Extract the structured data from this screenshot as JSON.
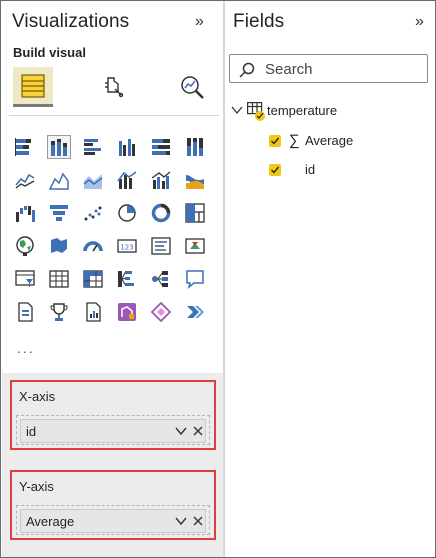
{
  "visualizations": {
    "title": "Visualizations",
    "collapse_glyph": "»",
    "build_visual_label": "Build visual",
    "build_icons": [
      "build-visual-icon",
      "format-visual-icon",
      "analytics-icon"
    ],
    "viz_icons": [
      "stacked-bar-chart-icon",
      "stacked-column-chart-icon",
      "clustered-bar-chart-icon",
      "clustered-column-chart-icon",
      "100-stacked-bar-chart-icon",
      "100-stacked-column-chart-icon",
      "line-chart-icon",
      "area-chart-icon",
      "stacked-area-chart-icon",
      "line-and-stacked-column-chart-icon",
      "line-and-clustered-column-chart-icon",
      "ribbon-chart-icon",
      "waterfall-chart-icon",
      "funnel-chart-icon",
      "scatter-chart-icon",
      "pie-chart-icon",
      "donut-chart-icon",
      "treemap-icon",
      "map-icon",
      "filled-map-icon",
      "gauge-icon",
      "card-icon",
      "multi-row-card-icon",
      "kpi-icon",
      "slicer-icon",
      "table-icon",
      "matrix-icon",
      "decomposition-tree-icon",
      "key-influencers-icon",
      "qa-icon",
      "paginated-report-icon",
      "goals-icon",
      "smart-narrative-icon",
      "power-apps-icon",
      "power-automate-icon",
      "arrow-chevron-icon"
    ],
    "selected_viz": "stacked-column-chart-icon",
    "more_glyph": "...",
    "x_axis": {
      "label": "X-axis",
      "field": "id"
    },
    "y_axis": {
      "label": "Y-axis",
      "field": "Average"
    }
  },
  "fields": {
    "title": "Fields",
    "collapse_glyph": "»",
    "search_placeholder": "Search",
    "table": {
      "name": "temperature",
      "items": [
        {
          "name": "Average",
          "type": "measure",
          "checked": true
        },
        {
          "name": "id",
          "type": "column",
          "checked": true
        }
      ]
    }
  },
  "colors": {
    "accent_yellow": "#f2c811",
    "highlight_red": "#e03e3e",
    "icon_blue": "#3f6fb5"
  }
}
